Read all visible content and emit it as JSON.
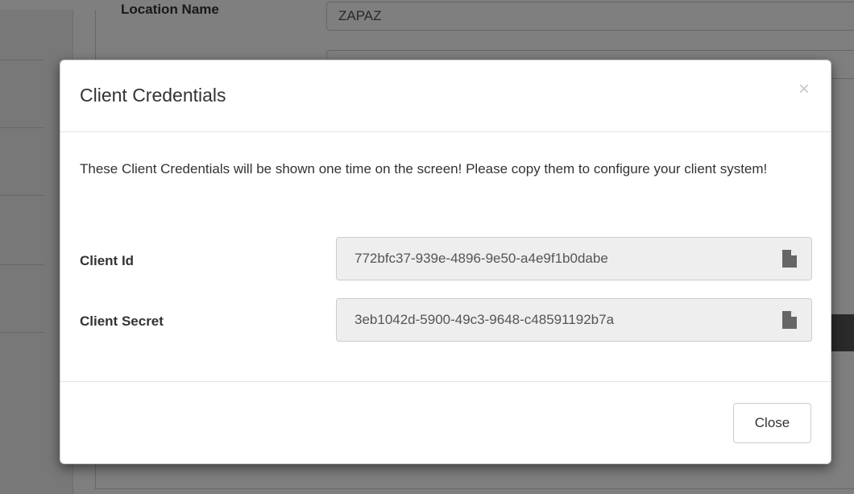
{
  "background": {
    "location_label": "Location Name",
    "location_value": "ZAPAZ"
  },
  "modal": {
    "title": "Client Credentials",
    "close_icon": "×",
    "message": "These Client Credentials will be shown one time on the screen! Please copy them to configure your client system!",
    "fields": [
      {
        "label": "Client Id",
        "value": "772bfc37-939e-4896-9e50-a4e9f1b0dabe",
        "icon": "copy-icon"
      },
      {
        "label": "Client Secret",
        "value": "3eb1042d-5900-49c3-9648-c48591192b7a",
        "icon": "copy-icon"
      }
    ],
    "close_label": "Close"
  },
  "colors": {
    "backdrop": "#000000",
    "input_readonly_bg": "#eeeeee",
    "border": "#cccccc"
  }
}
